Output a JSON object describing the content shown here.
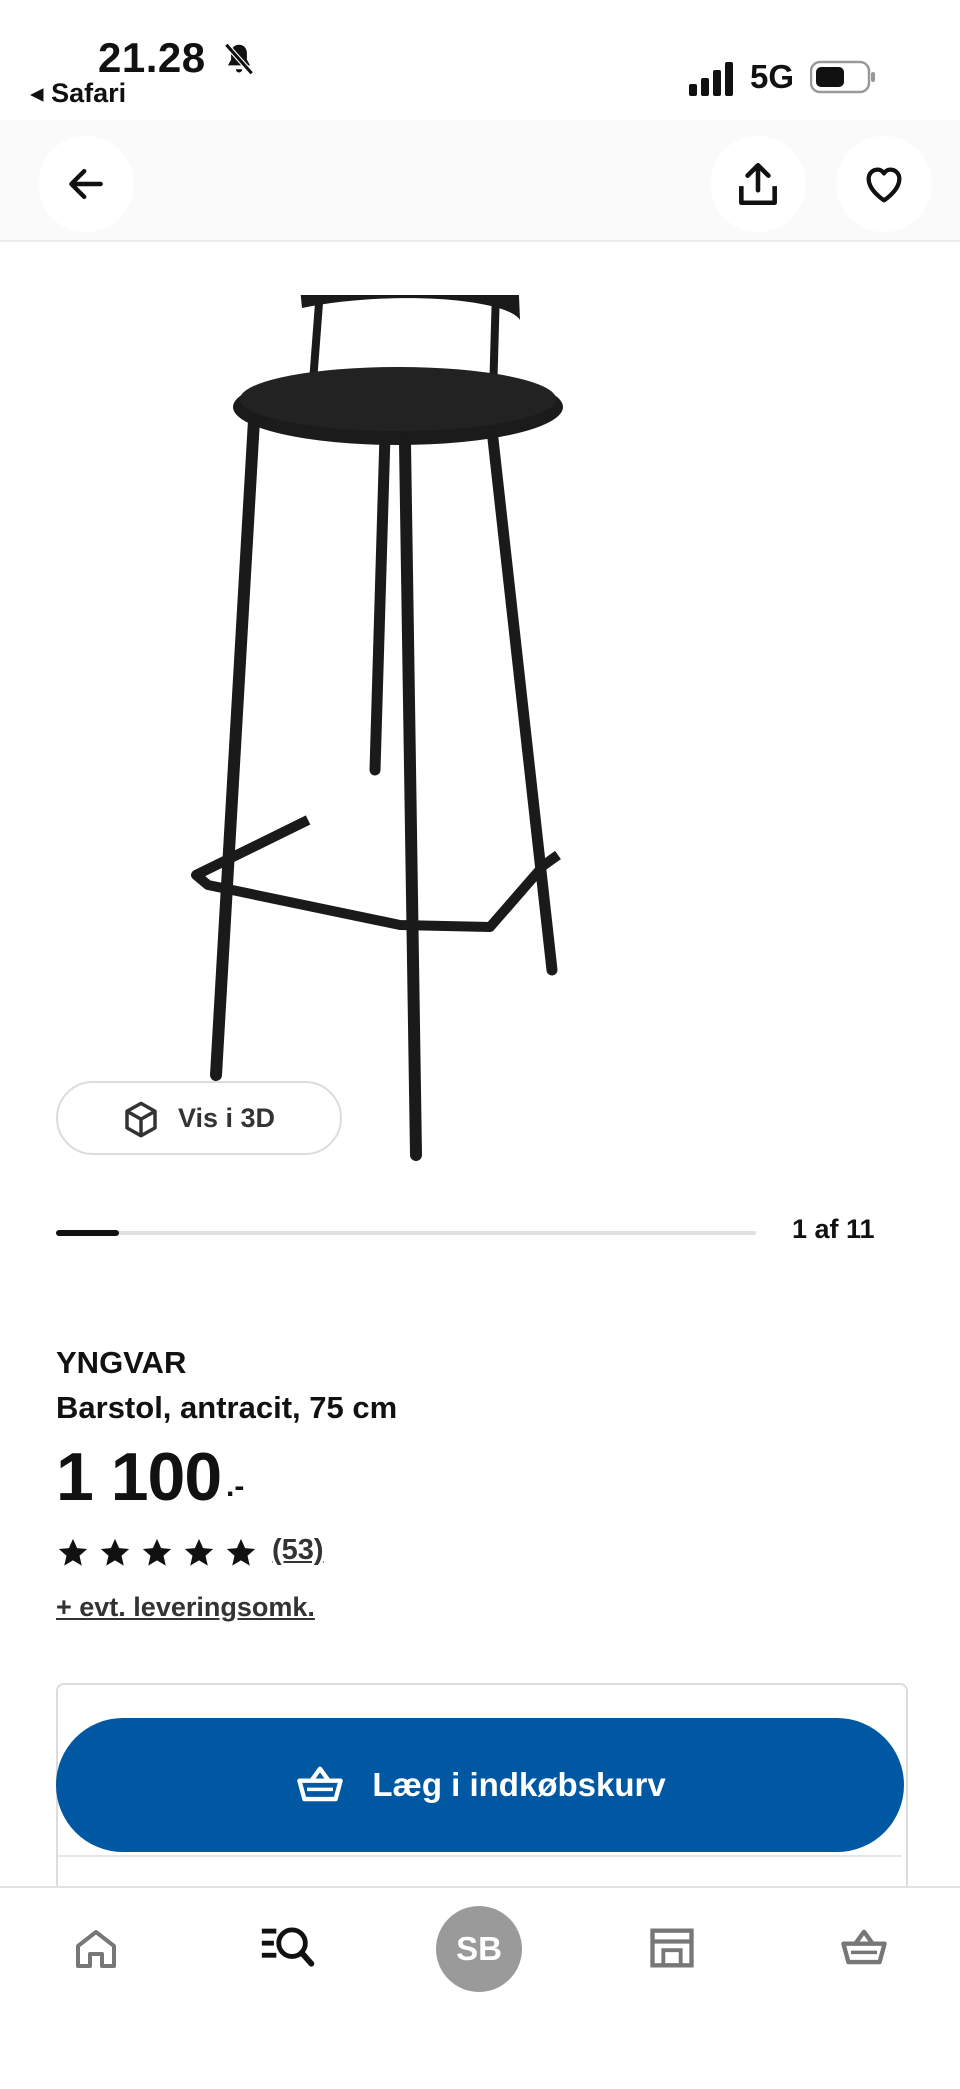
{
  "status_bar": {
    "time": "21.28",
    "back_app": "Safari",
    "network": "5G"
  },
  "top_nav": {
    "back": "arrow-left-icon",
    "share": "share-icon",
    "favorite": "heart-icon"
  },
  "gallery": {
    "view_3d_label": "Vis i 3D",
    "counter": "1 af 11",
    "progress": 0.09
  },
  "product": {
    "brand": "YNGVAR",
    "description": "Barstol, antracit, 75 cm",
    "price": "1 100",
    "price_suffix": ".-",
    "rating": 5,
    "reviews": "(53)",
    "delivery_note": "+ evt. leveringsomk."
  },
  "cta": {
    "add_to_cart": "Læg i indkøbskurv",
    "button_color": "#0058a3"
  },
  "bottom_nav": {
    "items": [
      "home-icon",
      "search-list-icon",
      "profile-avatar",
      "store-icon",
      "basket-icon"
    ],
    "avatar_initials": "SB"
  }
}
